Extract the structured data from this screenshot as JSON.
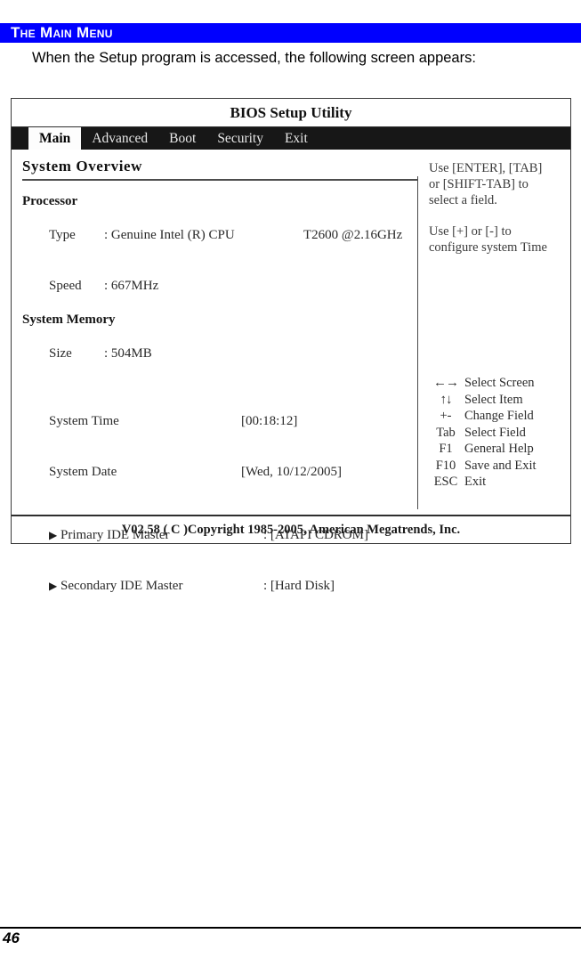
{
  "document": {
    "section_heading": "The Main Menu",
    "intro_paragraph": "When the Setup program is accessed, the following screen appears:",
    "page_number": "46",
    "accent_color": "#0000ff"
  },
  "bios": {
    "title": "BIOS Setup Utility",
    "tabs": [
      {
        "label": "Main",
        "active": true
      },
      {
        "label": "Advanced",
        "active": false
      },
      {
        "label": "Boot",
        "active": false
      },
      {
        "label": "Security",
        "active": false
      },
      {
        "label": "Exit",
        "active": false
      }
    ],
    "left_pane": {
      "heading": "System Overview",
      "processor_group": "Processor",
      "processor": {
        "type_label": "Type",
        "type_sep": ": Genuine Intel (R) CPU",
        "type_model": "T2600 @2.16GHz",
        "speed_label": "Speed",
        "speed_value": ": 667MHz"
      },
      "memory_group": "System Memory",
      "memory": {
        "size_label": "Size",
        "size_value": ": 504MB"
      },
      "time_label": "System Time",
      "time_value": "[00:18:12]",
      "date_label": "System Date",
      "date_value": "[Wed, 10/12/2005]",
      "ide": [
        {
          "bullet": "triangle-right-icon",
          "label": "Primary IDE Master",
          "value": ": [ATAPI CDROM]"
        },
        {
          "bullet": "triangle-right-icon",
          "label": "Secondary IDE Master",
          "value": ": [Hard Disk]"
        }
      ]
    },
    "right_pane": {
      "help_block_1": [
        "Use [ENTER], [TAB]",
        "or [SHIFT-TAB] to",
        "select a field."
      ],
      "help_block_2": [
        "Use [+] or [-] to",
        "configure system Time"
      ],
      "key_legend": [
        {
          "key": "←→",
          "glyph": true,
          "desc": "Select Screen"
        },
        {
          "key": "↑↓",
          "glyph": true,
          "desc": "Select Item"
        },
        {
          "key": "+-",
          "glyph": false,
          "desc": "Change Field"
        },
        {
          "key": "Tab",
          "glyph": false,
          "desc": "Select Field"
        },
        {
          "key": "F1",
          "glyph": false,
          "desc": "General Help"
        },
        {
          "key": "F10",
          "glyph": false,
          "desc": "Save and Exit"
        },
        {
          "key": "ESC",
          "glyph": false,
          "desc": "Exit"
        }
      ]
    },
    "footer": "V02.58 ( C )Copyright 1985-2005, American Megatrends, Inc."
  }
}
